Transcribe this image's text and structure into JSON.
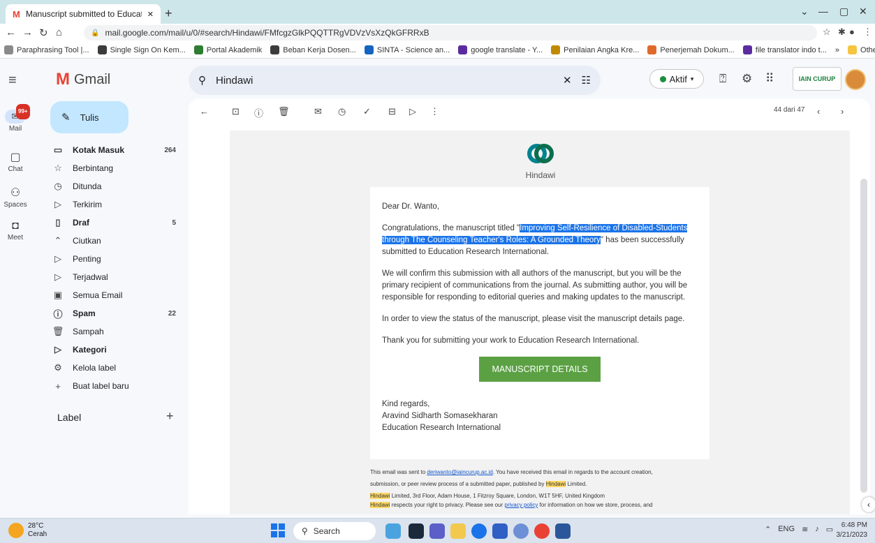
{
  "browser": {
    "tab_title": "Manuscript submitted to Educati",
    "url": "mail.google.com/mail/u/0/#search/Hindawi/FMfcgzGlkPQQTTRgVDVzVsXzQkGFRRxB",
    "bookmarks": [
      {
        "label": "Paraphrasing Tool |...",
        "color": "#8a8a8a"
      },
      {
        "label": "Single Sign On Kem...",
        "color": "#3c3c3c"
      },
      {
        "label": "Portal Akademik",
        "color": "#2e7d32"
      },
      {
        "label": "Beban Kerja Dosen...",
        "color": "#3c3c3c"
      },
      {
        "label": "SINTA - Science an...",
        "color": "#1565c0"
      },
      {
        "label": "google translate - Y...",
        "color": "#5b2ca0"
      },
      {
        "label": "Penilaian Angka Kre...",
        "color": "#c08a00"
      },
      {
        "label": "Penerjemah Dokum...",
        "color": "#e06a2b"
      },
      {
        "label": "file translator indo t...",
        "color": "#5b2ca0"
      }
    ],
    "bookmarks_more": "»",
    "other_bookmarks": "Other bookmarks"
  },
  "gmail": {
    "logo_text": "Gmail",
    "search_value": "Hindawi",
    "status_label": "Aktif",
    "org_logo_text": "IAIN CURUP",
    "rail": {
      "mail_label": "Mail",
      "mail_badge": "99+",
      "chat_label": "Chat",
      "spaces_label": "Spaces",
      "meet_label": "Meet"
    },
    "compose_label": "Tulis",
    "nav": [
      {
        "icon": "▭",
        "label": "Kotak Masuk",
        "count": "264",
        "bold": true
      },
      {
        "icon": "☆",
        "label": "Berbintang",
        "count": "",
        "bold": false
      },
      {
        "icon": "◷",
        "label": "Ditunda",
        "count": "",
        "bold": false
      },
      {
        "icon": "▷",
        "label": "Terkirim",
        "count": "",
        "bold": false
      },
      {
        "icon": "▯",
        "label": "Draf",
        "count": "5",
        "bold": true
      },
      {
        "icon": "⌃",
        "label": "Ciutkan",
        "count": "",
        "bold": false
      },
      {
        "icon": "▷",
        "label": "Penting",
        "count": "",
        "bold": false
      },
      {
        "icon": "▷",
        "label": "Terjadwal",
        "count": "",
        "bold": false
      },
      {
        "icon": "▣",
        "label": "Semua Email",
        "count": "",
        "bold": false
      },
      {
        "icon": "ⓘ",
        "label": "Spam",
        "count": "22",
        "bold": true
      },
      {
        "icon": "🗑",
        "label": "Sampah",
        "count": "",
        "bold": false
      },
      {
        "icon": "▷",
        "label": "Kategori",
        "count": "",
        "bold": true
      },
      {
        "icon": "⚙",
        "label": "Kelola label",
        "count": "",
        "bold": false
      },
      {
        "icon": "+",
        "label": "Buat label baru",
        "count": "",
        "bold": false
      }
    ],
    "label_header": "Label",
    "message_counter": "44 dari 47"
  },
  "email": {
    "brand": "Hindawi",
    "greeting": "Dear Dr. Wanto,",
    "p1_before": "Congratulations, the manuscript titled \"",
    "p1_title": "Improving Self-Resilience of Disabled-Students through The Counseling Teacher's Roles: A Grounded Theory",
    "p1_after": "\" has been successfully submitted to Education Research International.",
    "p2": "We will confirm this submission with all authors of the manuscript, but you will be the primary recipient of communications from the journal. As submitting author, you will be responsible for responding to editorial queries and making updates to the manuscript.",
    "p3": "In order to view the status of the manuscript, please visit the manuscript details page.",
    "p4": "Thank you for submitting your work to Education Research International.",
    "button": "MANUSCRIPT DETAILS",
    "signoff": "Kind regards,",
    "sender_name": "Aravind Sidharth Somasekharan",
    "sender_org": "Education Research International",
    "footer": {
      "l1_before": "This email was sent to ",
      "l1_email": "deriwanto@iaincurup.ac.id",
      "l1_after": ". You have received this email in regards to the account creation,",
      "l2_before": "submission, or peer review process of a submitted paper, published by ",
      "l2_brand": "Hindawi",
      "l2_after": " Limited.",
      "l3_brand": "Hindawi",
      "l3_after": " Limited, 3rd Floor, Adam House, 1 Fitzroy Square, London, W1T 5HF, United Kingdom",
      "l4_brand": "Hindawi",
      "l4_before": " respects your right to privacy. Please see our ",
      "l4_link": "privacy policy",
      "l4_after": " for information on how we store, process, and"
    }
  },
  "taskbar": {
    "temp": "28°C",
    "weather": "Cerah",
    "search_label": "Search",
    "lang": "ENG",
    "time": "6:48 PM",
    "date": "3/21/2023"
  }
}
